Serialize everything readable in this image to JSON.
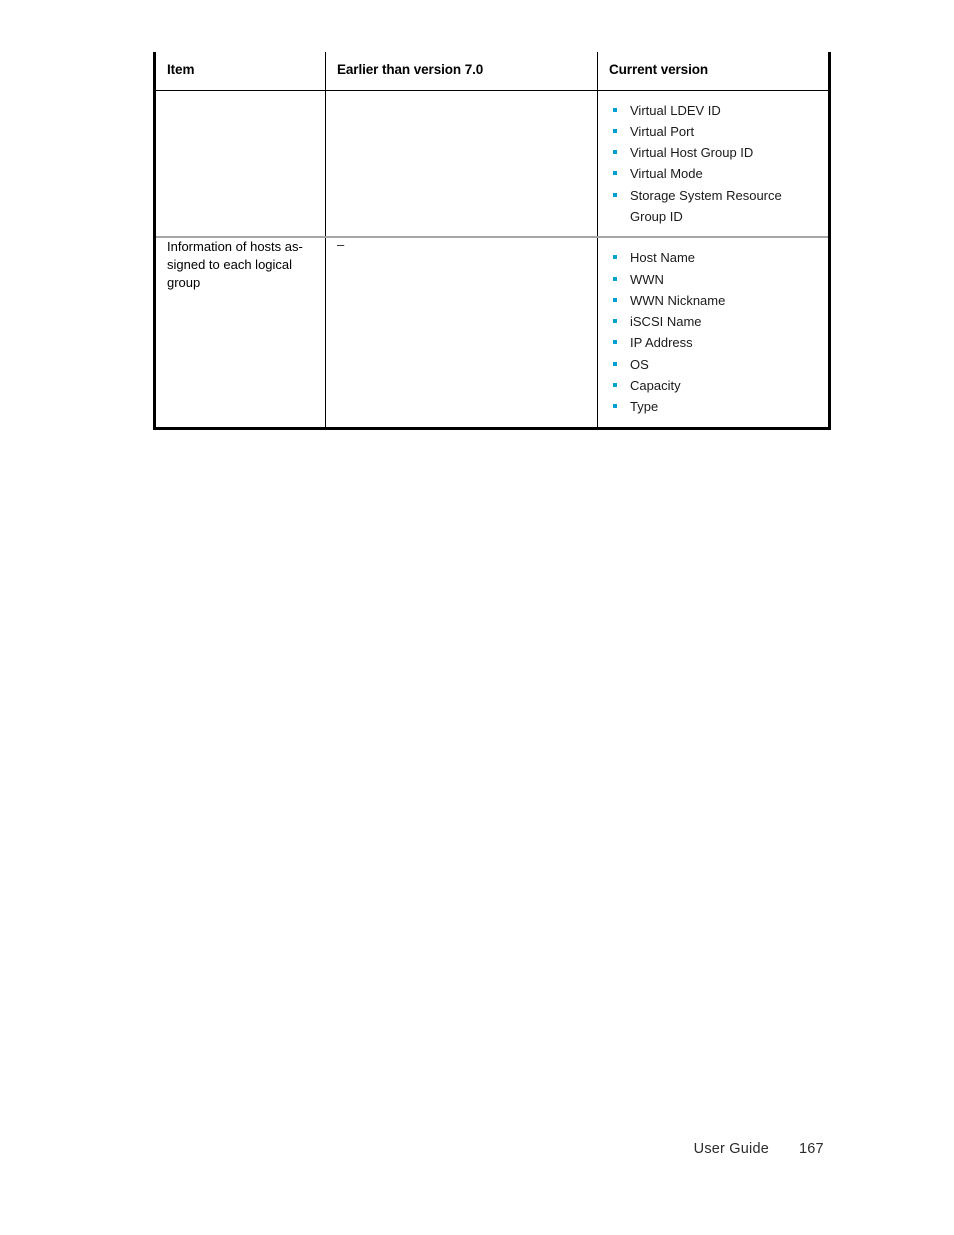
{
  "document": {
    "kind": "user-guide-page",
    "page_number": "167"
  },
  "table": {
    "headers": [
      "Item",
      "Earlier than version 7.0",
      "Current version"
    ],
    "rows": [
      {
        "item": "",
        "earlier": "",
        "current_bullets": [
          "Virtual LDEV ID",
          "Virtual Port",
          "Virtual Host Group ID",
          "Virtual Mode",
          "Storage System Resource Group ID"
        ]
      },
      {
        "item": "Information of hosts as-signed to each logical group",
        "earlier": "–",
        "current_bullets": [
          "Host Name",
          "WWN",
          "WWN Nickname",
          "iSCSI Name",
          "IP Address",
          "OS",
          "Capacity",
          "Type"
        ]
      }
    ]
  },
  "footer": {
    "label": "User Guide",
    "page_number": "167"
  },
  "colors": {
    "bullet": "#00a0d2",
    "border_outer": "#000000",
    "border_inner": "#000000",
    "row_divider": "#a6a6a6",
    "text": "#1a1a1a",
    "background": "#ffffff"
  }
}
